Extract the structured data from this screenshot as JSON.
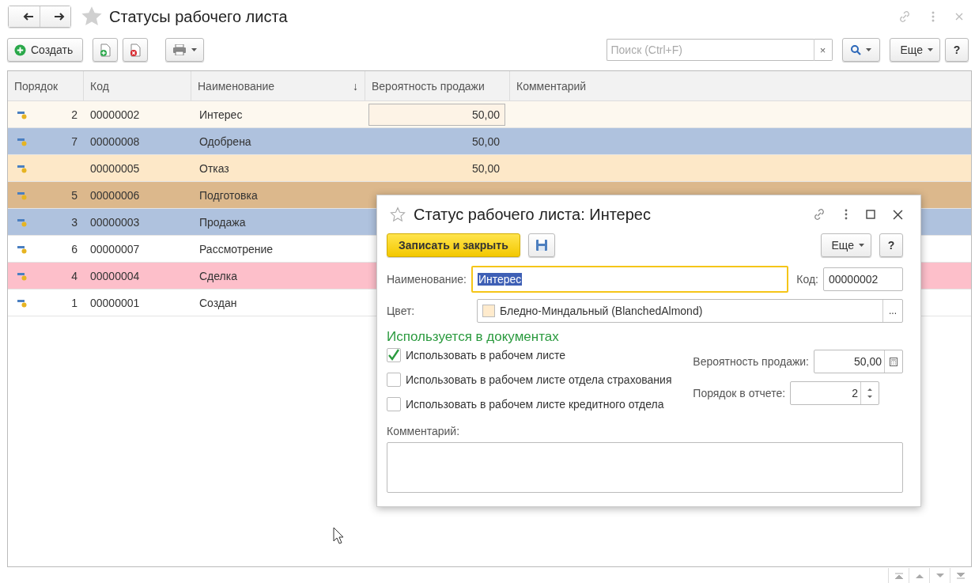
{
  "window": {
    "title": "Статусы рабочего листа"
  },
  "toolbar": {
    "create_button": "Создать",
    "search": {
      "placeholder": "Поиск (Ctrl+F)",
      "clear": "×"
    },
    "more_button": "Еще",
    "help_button": "?"
  },
  "table": {
    "columns": [
      {
        "label": "Порядок"
      },
      {
        "label": "Код"
      },
      {
        "label": "Наименование",
        "sort": "↓"
      },
      {
        "label": "Вероятность продажи"
      },
      {
        "label": "Комментарий"
      }
    ],
    "rows": [
      {
        "order": "2",
        "code": "00000002",
        "name": "Интерес",
        "probability": "50,00",
        "color": "#fdf8ef",
        "selected": true
      },
      {
        "order": "7",
        "code": "00000008",
        "name": "Одобрена",
        "probability": "50,00",
        "color": "#afc2de",
        "selected": false
      },
      {
        "code": "00000005",
        "name": "Отказ",
        "probability": "50,00",
        "color": "#fde8c8",
        "selected": false
      },
      {
        "order": "5",
        "code": "00000006",
        "name": "Подготовка",
        "color": "#dcb88c",
        "selected": false
      },
      {
        "order": "3",
        "code": "00000003",
        "name": "Продажа",
        "color": "#afc2de",
        "selected": false
      },
      {
        "order": "6",
        "code": "00000007",
        "name": "Рассмотрение",
        "color": "#ffffff",
        "selected": false
      },
      {
        "order": "4",
        "code": "00000004",
        "name": "Сделка",
        "color": "#fdbfca",
        "selected": false
      },
      {
        "order": "1",
        "code": "00000001",
        "name": "Создан",
        "color": "#ffffff",
        "selected": false
      }
    ]
  },
  "dialog": {
    "title": "Статус рабочего листа: Интерес",
    "save_close_button": "Записать и закрыть",
    "more_button": "Еще",
    "help_button": "?",
    "name_label": "Наименование:",
    "name_value": "Интерес",
    "code_label": "Код:",
    "code_value": "00000002",
    "color_field": {
      "label": "Цвет:",
      "value": "Бледно-Миндальный (BlanchedAlmond)",
      "color": "#ffebcd",
      "choose": "..."
    },
    "section_title": "Используется в документах",
    "checkboxes": [
      {
        "label": "Использовать в рабочем листе",
        "checked": true
      },
      {
        "label": "Использовать в рабочем листе отдела страхования",
        "checked": false
      },
      {
        "label": "Использовать в рабочем листе кредитного отдела",
        "checked": false
      }
    ],
    "probability_label": "Вероятность продажи:",
    "probability_value": "50,00",
    "order_label": "Порядок в отчете:",
    "order_value": "2",
    "comment_label": "Комментарий:"
  }
}
